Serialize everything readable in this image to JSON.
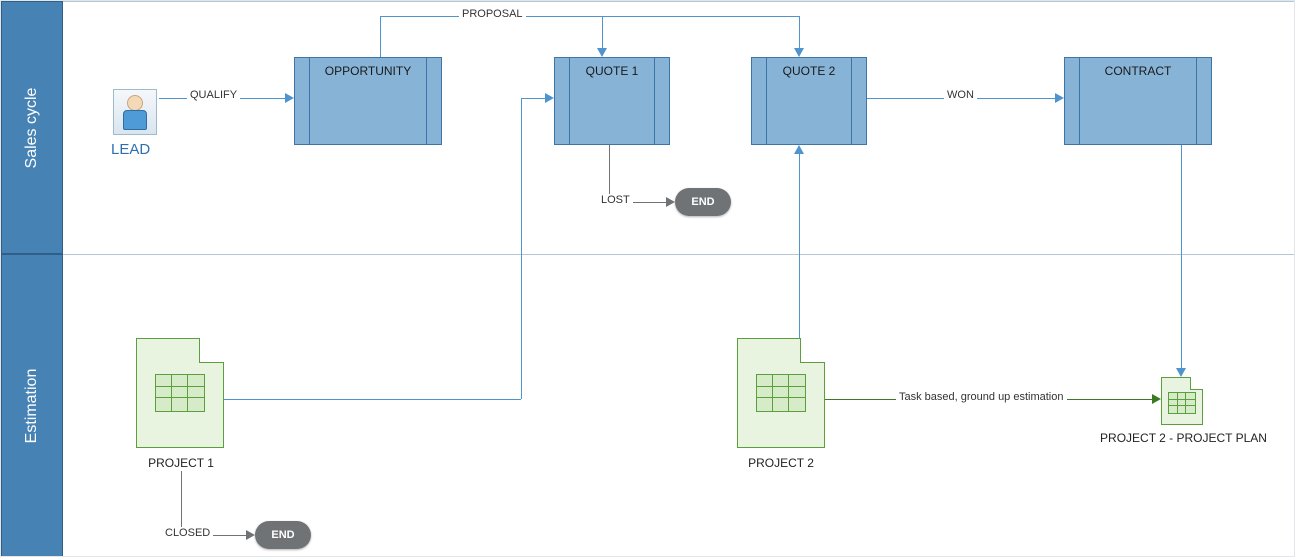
{
  "lanes": {
    "sales": "Sales cycle",
    "estimation": "Estimation"
  },
  "nodes": {
    "lead": "LEAD",
    "opportunity": "OPPORTUNITY",
    "quote1": "QUOTE 1",
    "quote2": "QUOTE 2",
    "contract": "CONTRACT",
    "end1": "END",
    "end2": "END",
    "project1": "PROJECT 1",
    "project2": "PROJECT 2",
    "project2plan": "PROJECT 2 - PROJECT PLAN"
  },
  "edges": {
    "qualify": "QUALIFY",
    "proposal": "PROPOSAL",
    "lost": "LOST",
    "won": "WON",
    "closed": "CLOSED",
    "taskbased": "Task based, ground up estimation"
  }
}
